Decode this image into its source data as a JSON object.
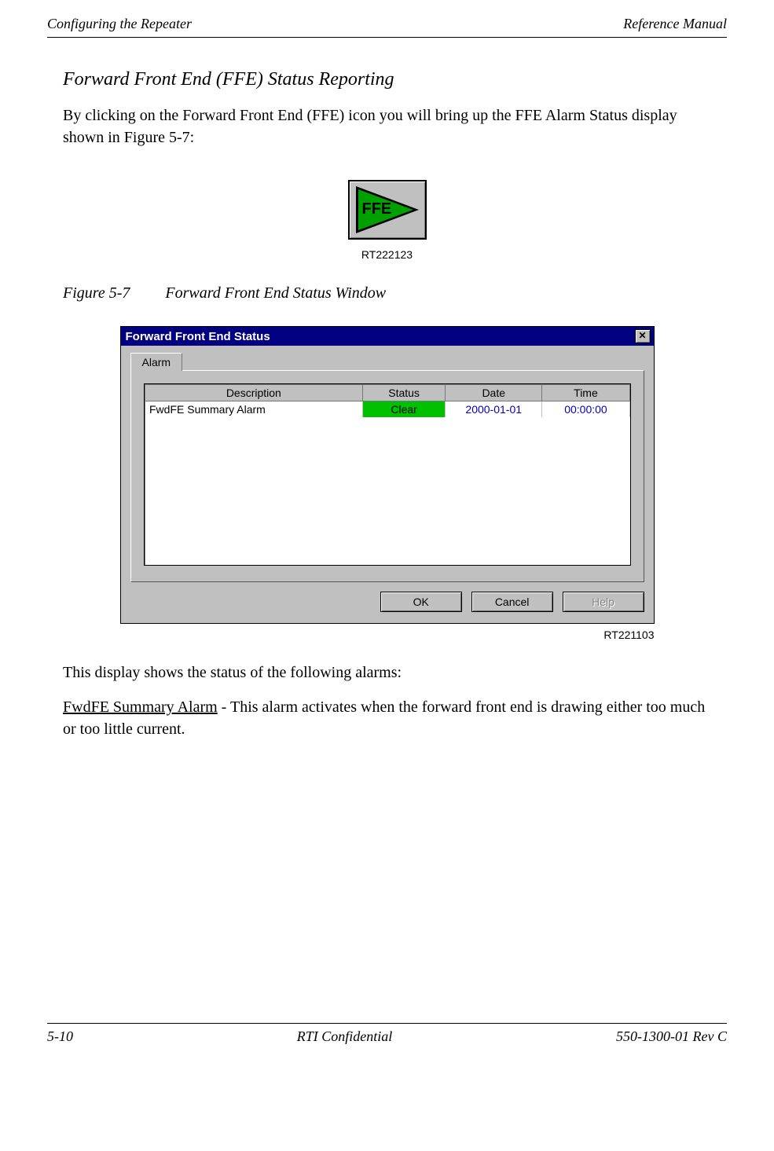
{
  "header": {
    "left": "Configuring the Repeater",
    "right": "Reference Manual"
  },
  "section": {
    "title": "Forward Front End (FFE) Status Reporting",
    "intro": "By clicking on the Forward Front End (FFE) icon you will bring up the FFE Alarm Status display shown in Figure 5-7:"
  },
  "icon": {
    "label": "FFE",
    "caption": "RT222123"
  },
  "figure": {
    "number": "Figure 5-7",
    "title": "Forward Front End Status Window"
  },
  "dialog": {
    "title": "Forward Front End Status",
    "close_glyph": "✕",
    "tab": "Alarm",
    "columns": {
      "description": "Description",
      "status": "Status",
      "date": "Date",
      "time": "Time"
    },
    "rows": [
      {
        "description": "FwdFE Summary Alarm",
        "status": "Clear",
        "date": "2000-01-01",
        "time": "00:00:00"
      }
    ],
    "buttons": {
      "ok": "OK",
      "cancel": "Cancel",
      "help": "Help"
    },
    "fig_code": "RT221103"
  },
  "body2": {
    "intro": "This display shows the status of the following alarms:",
    "alarm_name": "FwdFE Summary Alarm",
    "alarm_text": " - This alarm activates when the forward front end is drawing either too much or too little current."
  },
  "footer": {
    "left": "5-10",
    "center": "RTI Confidential",
    "right": "550-1300-01 Rev C"
  }
}
